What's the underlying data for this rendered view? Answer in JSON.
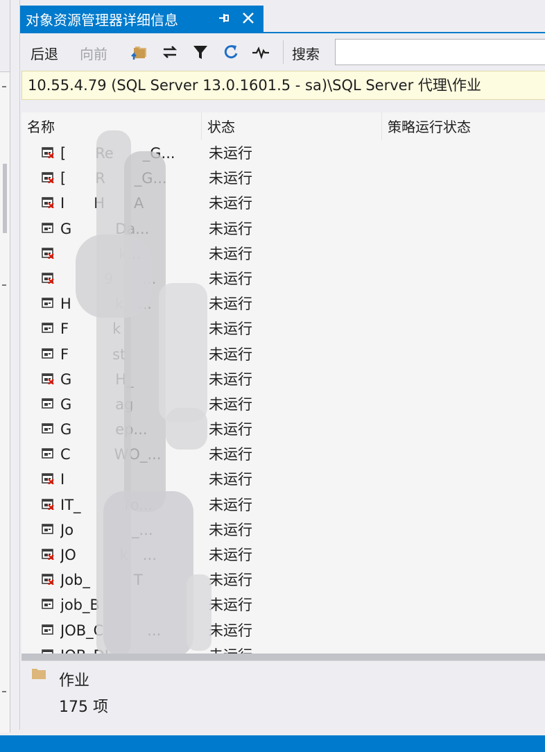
{
  "window": {
    "title": "对象资源管理器详细信息",
    "pin_glyph": "⊕",
    "close_glyph": "✕"
  },
  "toolbar": {
    "back_label": "后退",
    "forward_label": "向前",
    "search_label": "搜索",
    "search_value": "",
    "icons": [
      "sync-folder-icon",
      "refresh-arrows-icon",
      "filter-icon",
      "refresh-icon",
      "activity-monitor-icon"
    ]
  },
  "path": "10.55.4.79 (SQL Server 13.0.1601.5 - sa)\\SQL Server 代理\\作业",
  "columns": [
    "名称",
    "状态",
    "策略运行状态"
  ],
  "jobs": [
    {
      "name": "[  Re  _G...",
      "status": "未运行",
      "failed": true
    },
    {
      "name": "[  R  _G...",
      "status": "未运行",
      "failed": true
    },
    {
      "name": "I  H  A",
      "status": "未运行",
      "failed": true
    },
    {
      "name": "G   Da...",
      "status": "未运行",
      "failed": false
    },
    {
      "name": "    k...",
      "status": "未运行",
      "failed": true
    },
    {
      "name": "   9  ...",
      "status": "未运行",
      "failed": true
    },
    {
      "name": "H   k ...",
      "status": "未运行",
      "failed": false
    },
    {
      "name": "F   k ",
      "status": "未运行",
      "failed": false
    },
    {
      "name": "F   st",
      "status": "未运行",
      "failed": false
    },
    {
      "name": "G   H_ ",
      "status": "未运行",
      "failed": true
    },
    {
      "name": "G   ag",
      "status": "未运行",
      "failed": false
    },
    {
      "name": "G   ep...",
      "status": "未运行",
      "failed": false
    },
    {
      "name": "C   WO_...",
      "status": "未运行",
      "failed": false
    },
    {
      "name": "I    ",
      "status": "未运行",
      "failed": true
    },
    {
      "name": "IT_   ro...",
      "status": "未运行",
      "failed": true
    },
    {
      "name": "Jo    _...",
      "status": "未运行",
      "failed": false
    },
    {
      "name": "JO   k ...",
      "status": "未运行",
      "failed": true
    },
    {
      "name": "Job_   T",
      "status": "未运行",
      "failed": true
    },
    {
      "name": "job_B   ",
      "status": "未运行",
      "failed": false
    },
    {
      "name": "JOB_C   ...",
      "status": "未运行",
      "failed": false
    },
    {
      "name": "JOB_DI  ",
      "status": "未运行",
      "failed": false
    }
  ],
  "footer": {
    "title": "作业",
    "count": "175 项"
  },
  "colors": {
    "accent": "#007acc",
    "path_bg": "#fdfbe0",
    "list_bg": "#f5f5f5",
    "error_red": "#e51400"
  }
}
